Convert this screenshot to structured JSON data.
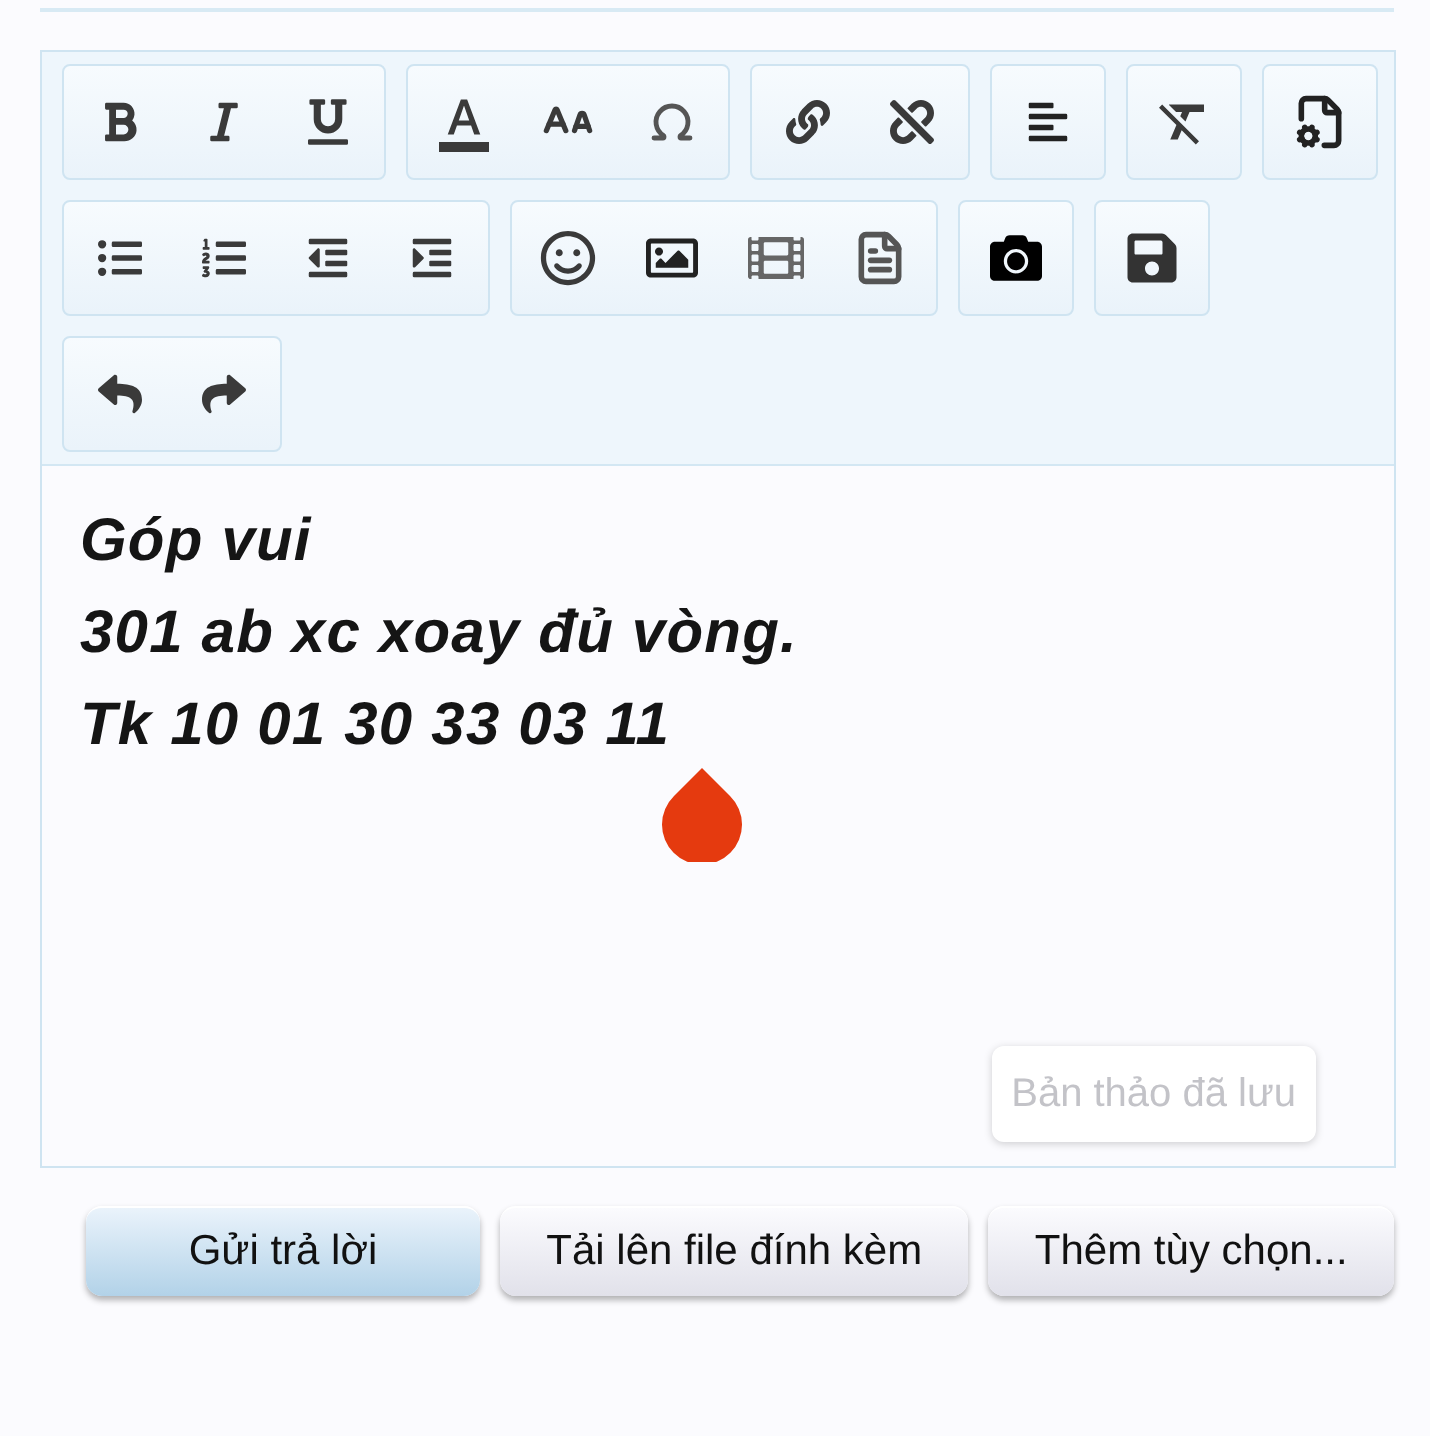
{
  "toolbar": {
    "rows": [
      {
        "groups": [
          {
            "buttons": [
              {
                "kind": "bold"
              },
              {
                "kind": "italic"
              },
              {
                "kind": "underline"
              }
            ]
          },
          {
            "buttons": [
              {
                "kind": "text_color"
              },
              {
                "kind": "font_size"
              },
              {
                "kind": "special_characters"
              }
            ]
          },
          {
            "buttons": [
              {
                "kind": "link"
              },
              {
                "kind": "unlink"
              }
            ]
          },
          {
            "buttons": [
              {
                "kind": "align"
              }
            ]
          },
          {
            "buttons": [
              {
                "kind": "clear_formatting"
              }
            ]
          },
          {
            "buttons": [
              {
                "kind": "template"
              }
            ]
          }
        ]
      },
      {
        "groups": [
          {
            "buttons": [
              {
                "kind": "bulleted_list"
              },
              {
                "kind": "numbered_list"
              },
              {
                "kind": "outdent"
              },
              {
                "kind": "indent"
              }
            ]
          },
          {
            "buttons": [
              {
                "kind": "smilies"
              },
              {
                "kind": "image"
              },
              {
                "kind": "media"
              },
              {
                "kind": "snippet"
              }
            ]
          },
          {
            "buttons": [
              {
                "kind": "screenshot"
              }
            ]
          },
          {
            "buttons": [
              {
                "kind": "save"
              }
            ]
          }
        ]
      },
      {
        "groups": [
          {
            "buttons": [
              {
                "kind": "undo"
              },
              {
                "kind": "redo"
              }
            ]
          }
        ]
      }
    ]
  },
  "editor": {
    "lines": [
      "Góp vui",
      "301 ab xc xoay đủ vòng.",
      "Tk 10 01 30 33 03 11"
    ],
    "draft_status": "Bản thảo đã lưu"
  },
  "actions": [
    {
      "label": "Gửi trả lời",
      "kind": "primary"
    },
    {
      "label": "Tải lên file đính kèm",
      "kind": "secondary"
    },
    {
      "label": "Thêm tùy chọn...",
      "kind": "secondary"
    }
  ]
}
